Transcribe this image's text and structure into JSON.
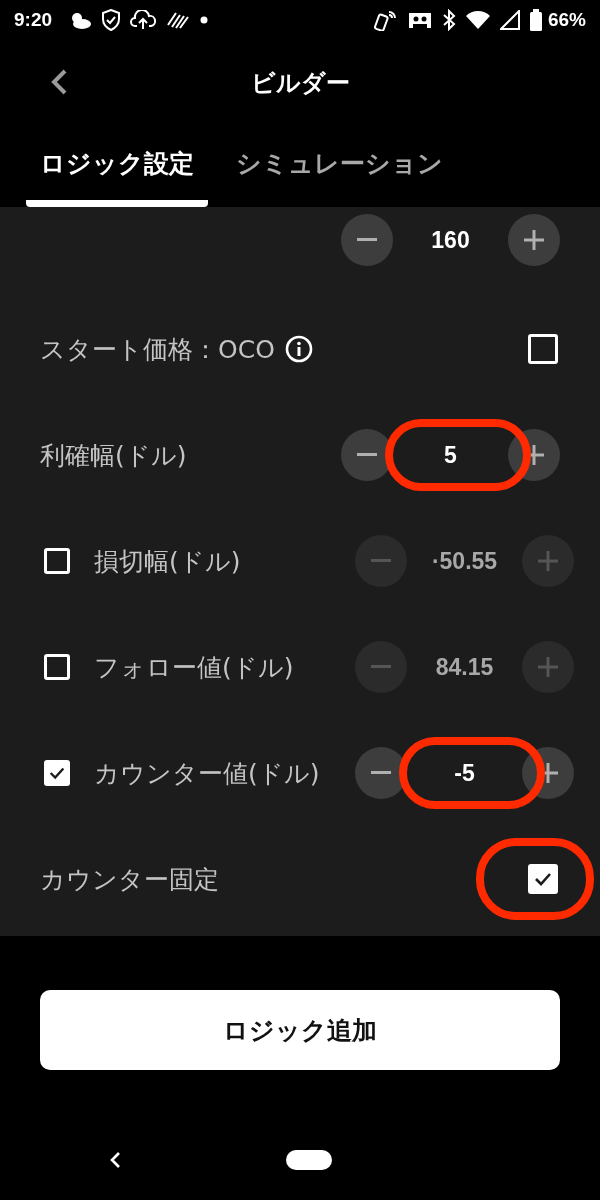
{
  "status_bar": {
    "time": "9:20",
    "battery": "66%"
  },
  "header": {
    "title": "ビルダー"
  },
  "tabs": [
    {
      "label": "ロジック設定",
      "selected": true
    },
    {
      "label": "シミュレーション",
      "selected": false
    }
  ],
  "rows": [
    {
      "kind": "stepper",
      "value": "160",
      "disabled": false
    },
    {
      "kind": "checkbox",
      "label": "スタート価格：OCO",
      "info": true,
      "checked": false
    },
    {
      "kind": "stepper",
      "label": "利確幅(ドル)",
      "value": "5",
      "disabled": false,
      "highlighted": true
    },
    {
      "kind": "stepper",
      "label": "損切幅(ドル)",
      "checked": false,
      "value": "·50.55",
      "disabled": true
    },
    {
      "kind": "stepper",
      "label": "フォロー値(ドル)",
      "checked": false,
      "value": "84.15",
      "disabled": true
    },
    {
      "kind": "stepper",
      "label": "カウンター値(ドル)",
      "checked": true,
      "value": "-5",
      "disabled": false,
      "highlighted": true
    },
    {
      "kind": "checkbox",
      "label": "カウンター固定",
      "checked": true,
      "highlighted": true
    }
  ],
  "add_button": "ロジック追加"
}
